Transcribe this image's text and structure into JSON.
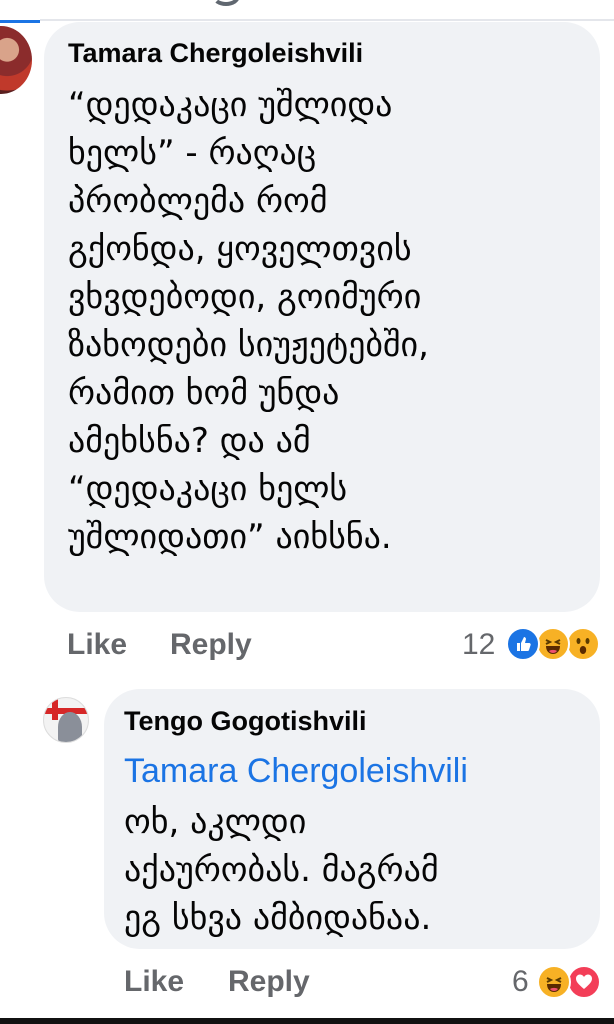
{
  "colors": {
    "bubble_bg": "#f0f2f5",
    "link_blue": "#1b74e4",
    "action_gray": "#65676b",
    "text": "#050505"
  },
  "comment": {
    "author": "Tamara Chergoleishvili",
    "text": "“დედაკაცი უშლიდა\nხელს” - რაღაც\nპრობლემა რომ\nგქონდა, ყოველთვის\nვხვდებოდი, გოიმური\nზახოდები სიუჟეტებში,\nრამით ხომ უნდა\nამეხსნა? და ამ\n“დედაკაცი ხელს\nუშლიდათი” აიხსნა.",
    "actions": {
      "like": "Like",
      "reply": "Reply"
    },
    "reaction_count": "12",
    "reactions": [
      "like-icon",
      "haha-icon",
      "wow-icon"
    ]
  },
  "reply": {
    "author": "Tengo Gogotishvili",
    "mention": "Tamara Chergoleishvili",
    "text": "ოხ, აკლდი\nაქაურობას. მაგრამ\nეგ სხვა ამბიდანაა.",
    "actions": {
      "like": "Like",
      "reply": "Reply"
    },
    "reaction_count": "6",
    "reactions": [
      "haha-icon",
      "love-icon"
    ]
  }
}
